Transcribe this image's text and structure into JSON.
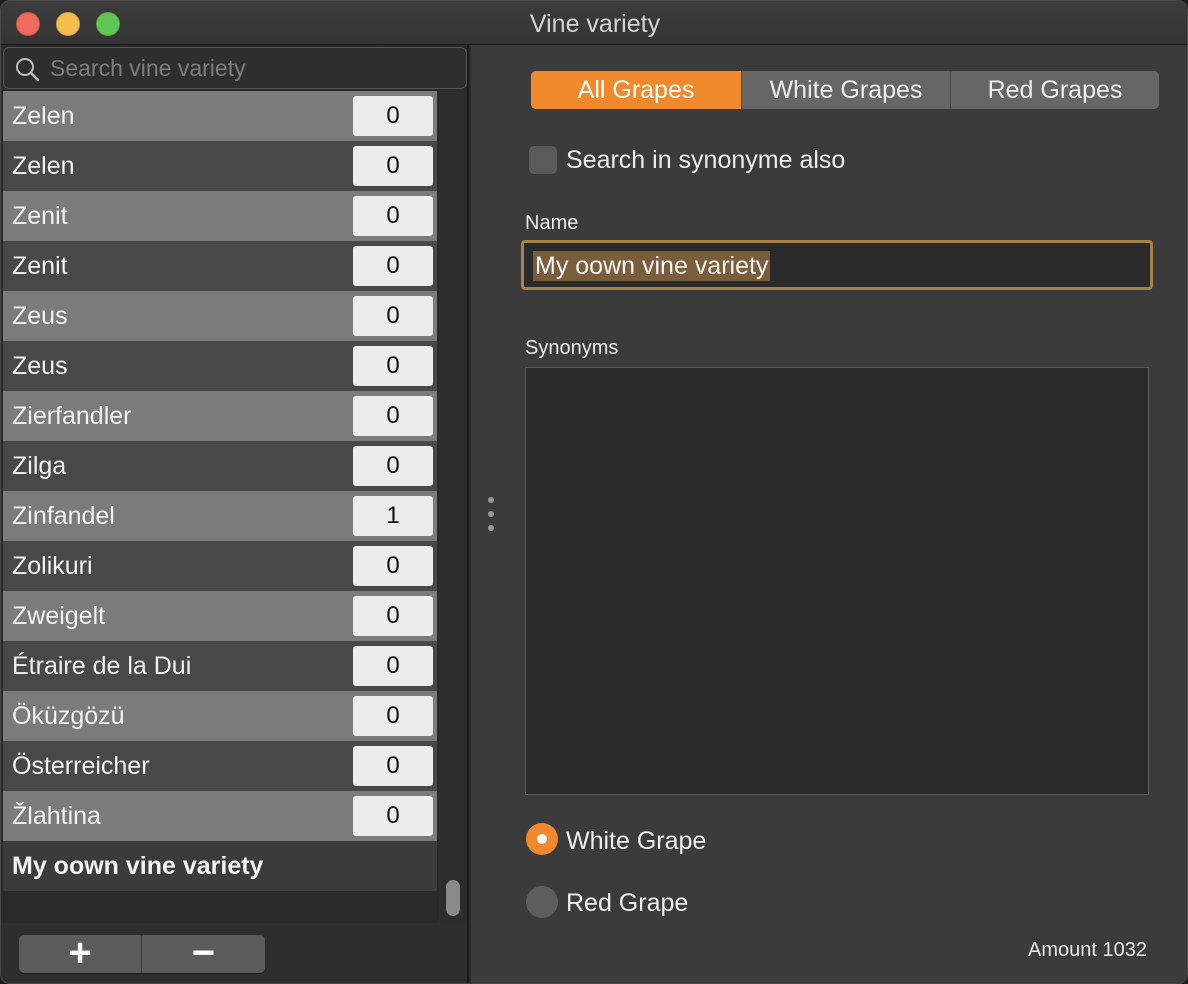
{
  "window": {
    "title": "Vine variety"
  },
  "search": {
    "placeholder": "Search vine variety",
    "value": ""
  },
  "varieties": [
    {
      "name": "Zelen",
      "count": "0"
    },
    {
      "name": "Zelen",
      "count": "0"
    },
    {
      "name": "Zenit",
      "count": "0"
    },
    {
      "name": "Zenit",
      "count": "0"
    },
    {
      "name": "Zeus",
      "count": "0"
    },
    {
      "name": "Zeus",
      "count": "0"
    },
    {
      "name": "Zierfandler",
      "count": "0"
    },
    {
      "name": "Zilga",
      "count": "0"
    },
    {
      "name": "Zinfandel",
      "count": "1"
    },
    {
      "name": "Zolikuri",
      "count": "0"
    },
    {
      "name": "Zweigelt",
      "count": "0"
    },
    {
      "name": "Étraire de la Dui",
      "count": "0"
    },
    {
      "name": "Öküzgözü",
      "count": "0"
    },
    {
      "name": "Österreicher",
      "count": "0"
    },
    {
      "name": "Žlahtina",
      "count": "0"
    },
    {
      "name": "My oown vine variety",
      "count": null,
      "selected": true
    }
  ],
  "list_buttons": {
    "add": "+",
    "remove": "−"
  },
  "filter_tabs": [
    {
      "label": "All Grapes",
      "active": true
    },
    {
      "label": "White Grapes",
      "active": false
    },
    {
      "label": "Red Grapes",
      "active": false
    }
  ],
  "synonym_search": {
    "label": "Search in synonyme also",
    "checked": false
  },
  "form": {
    "name_label": "Name",
    "name_value": "My oown vine variety",
    "synonyms_label": "Synonyms",
    "synonyms_value": ""
  },
  "grape_type": {
    "options": [
      {
        "label": "White Grape",
        "selected": true
      },
      {
        "label": "Red Grape",
        "selected": false
      }
    ]
  },
  "footer": {
    "amount": "Amount 1032"
  },
  "colors": {
    "accent": "#f0892b",
    "field_focus": "#a78248",
    "selection": "#7a5e3c"
  }
}
